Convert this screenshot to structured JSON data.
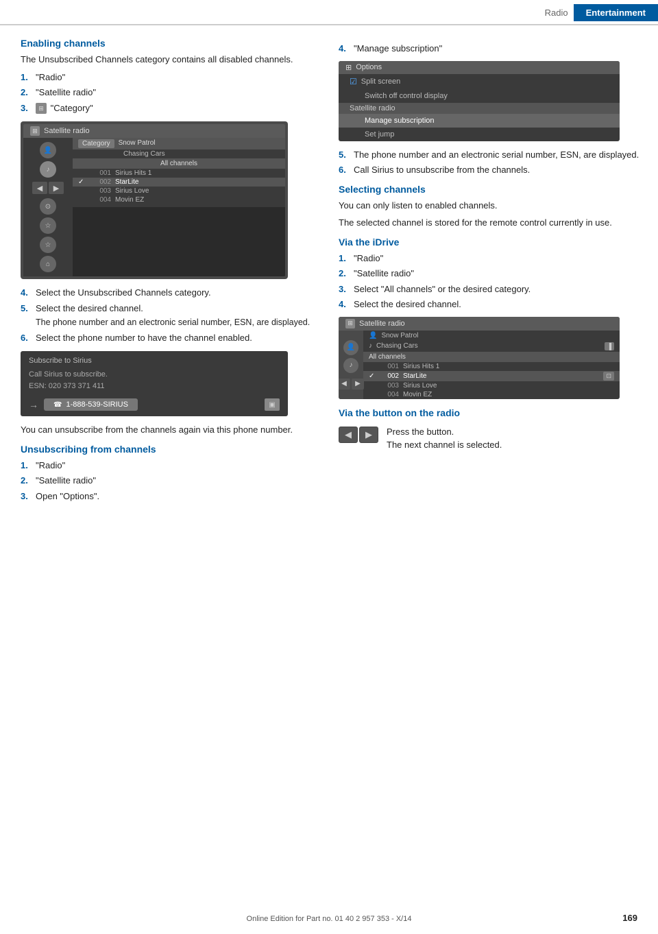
{
  "header": {
    "radio_label": "Radio",
    "section_label": "Entertainment"
  },
  "left_column": {
    "enabling_channels": {
      "title": "Enabling channels",
      "intro": "The Unsubscribed Channels category contains all disabled channels.",
      "steps": [
        {
          "num": "1.",
          "text": "\"Radio\""
        },
        {
          "num": "2.",
          "text": "\"Satellite radio\""
        },
        {
          "num": "3.",
          "text": "\"Category\"",
          "icon": true
        },
        {
          "num": "4.",
          "text": "Select the Unsubscribed Channels category."
        },
        {
          "num": "5.",
          "text": "Select the desired channel.",
          "subtext": "The phone number and an electronic serial number, ESN, are displayed."
        },
        {
          "num": "6.",
          "text": "Select the phone number to have the channel enabled."
        }
      ]
    },
    "screen1": {
      "title": "Satellite radio",
      "category_label": "Category",
      "song1": "Snow Patrol",
      "song2": "Chasing Cars",
      "all_channels": "All channels",
      "channels": [
        {
          "num": "001",
          "name": "Sirius Hits 1",
          "checked": false
        },
        {
          "num": "002",
          "name": "StarLite",
          "checked": true
        },
        {
          "num": "003",
          "name": "Sirius Love",
          "checked": false
        },
        {
          "num": "004",
          "name": "Movin EZ",
          "checked": false
        }
      ]
    },
    "subscribe_screen": {
      "title": "Subscribe to Sirius",
      "line1": "Call Sirius to subscribe.",
      "line2": "ESN: 020 373 371 411",
      "phone": "1-888-539-SIRIUS"
    },
    "unsubscribe_note": "You can unsubscribe from the channels again via this phone number.",
    "unsubscribing": {
      "title": "Unsubscribing from channels",
      "steps": [
        {
          "num": "1.",
          "text": "\"Radio\""
        },
        {
          "num": "2.",
          "text": "\"Satellite radio\""
        },
        {
          "num": "3.",
          "text": "Open \"Options\"."
        }
      ]
    }
  },
  "right_column": {
    "step4_label": "4.",
    "step4_text": "\"Manage subscription\"",
    "step5_label": "5.",
    "step5_text": "The phone number and an electronic serial number, ESN, are displayed.",
    "step6_label": "6.",
    "step6_text": "Call Sirius to unsubscribe from the channels.",
    "options_screen": {
      "title": "Options",
      "items": [
        {
          "text": "Split screen",
          "checked": true
        },
        {
          "text": "Switch off control display",
          "checked": false
        },
        {
          "text": "Satellite radio",
          "divider": true
        },
        {
          "text": "Manage subscription",
          "highlighted": true
        },
        {
          "text": "Set jump",
          "divider_above": false
        }
      ]
    },
    "selecting_channels": {
      "title": "Selecting channels",
      "intro1": "You can only listen to enabled channels.",
      "intro2": "The selected channel is stored for the remote control currently in use."
    },
    "via_idrive": {
      "title": "Via the iDrive",
      "steps": [
        {
          "num": "1.",
          "text": "\"Radio\""
        },
        {
          "num": "2.",
          "text": "\"Satellite radio\""
        },
        {
          "num": "3.",
          "text": "Select \"All channels\" or the desired category."
        },
        {
          "num": "4.",
          "text": "Select the desired channel."
        }
      ]
    },
    "screen2": {
      "title": "Satellite radio",
      "song1": "Snow Patrol",
      "song2": "Chasing Cars",
      "all_channels": "All channels",
      "channels": [
        {
          "num": "001",
          "name": "Sirius Hits 1",
          "checked": false
        },
        {
          "num": "002",
          "name": "StarLite",
          "checked": true
        },
        {
          "num": "003",
          "name": "Sirius Love",
          "checked": false
        },
        {
          "num": "004",
          "name": "Movin EZ",
          "checked": false
        }
      ]
    },
    "via_button": {
      "title": "Via the button on the radio",
      "press_label": "Press the button.",
      "next_label": "The next channel is selected."
    }
  },
  "footer": {
    "text": "Online Edition for Part no. 01 40 2 957 353 - X/14",
    "page": "169"
  }
}
